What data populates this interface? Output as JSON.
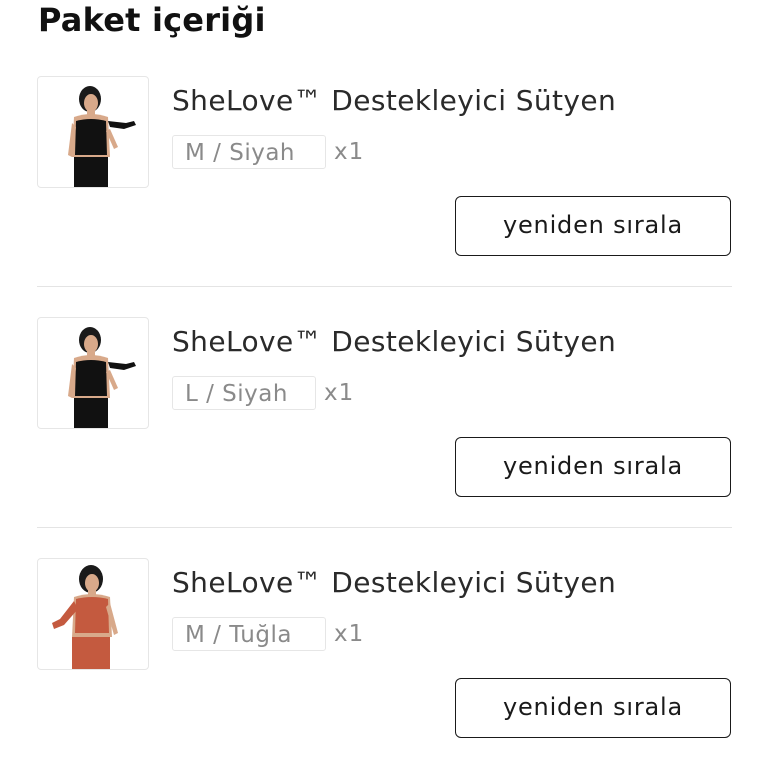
{
  "page": {
    "title": "Paket içeriği"
  },
  "items": [
    {
      "name": "SheLove™ Destekleyici Sütyen",
      "variant": "M / Siyah",
      "quantity": "x1",
      "reorder_label": "yeniden sırala",
      "image_color": "#111111"
    },
    {
      "name": "SheLove™ Destekleyici Sütyen",
      "variant": "L / Siyah",
      "quantity": "x1",
      "reorder_label": "yeniden sırala",
      "image_color": "#111111"
    },
    {
      "name": "SheLove™ Destekleyici Sütyen",
      "variant": "M / Tuğla",
      "quantity": "x1",
      "reorder_label": "yeniden sırala",
      "image_color": "#c45a3f"
    }
  ]
}
